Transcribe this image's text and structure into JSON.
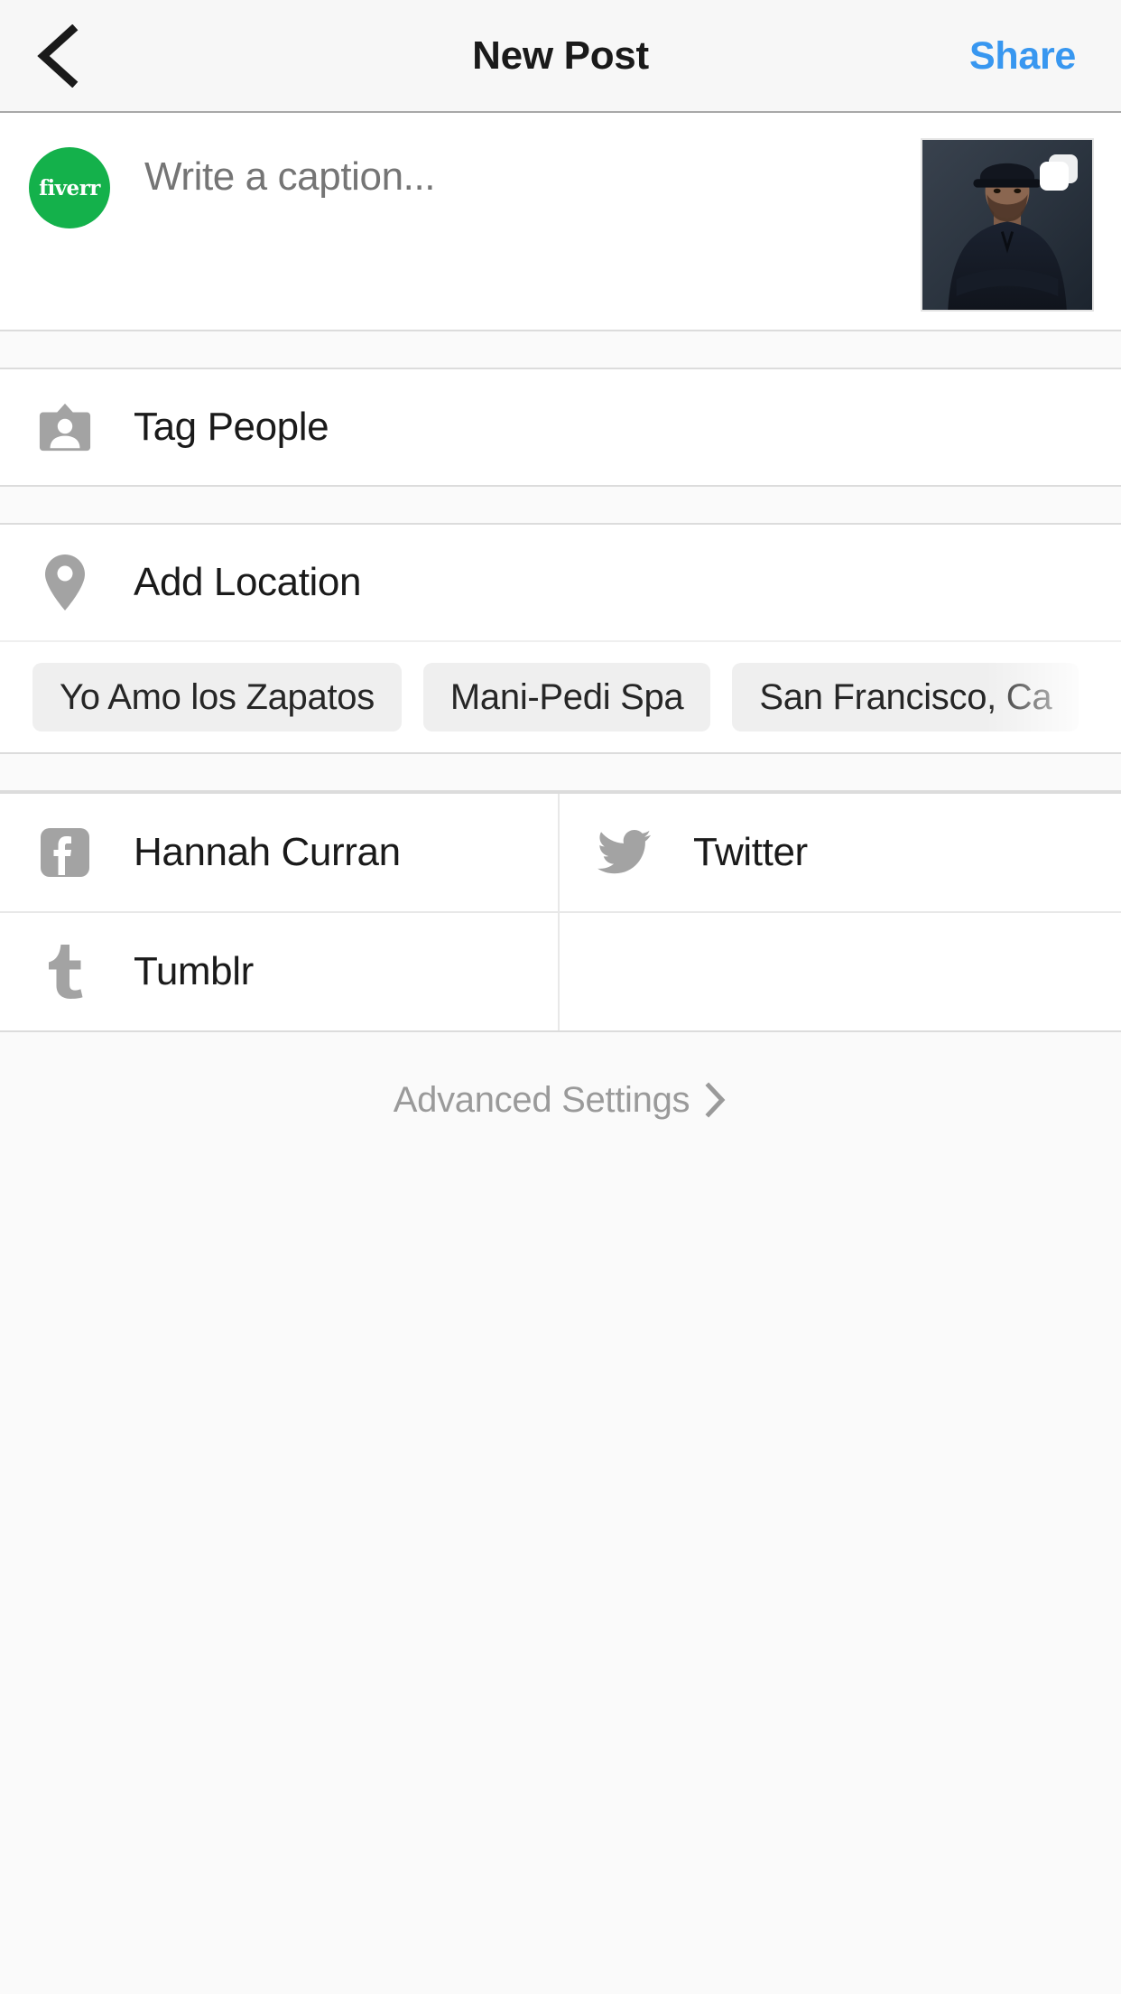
{
  "header": {
    "back_icon": "chevron-left-icon",
    "title": "New Post",
    "share_label": "Share"
  },
  "caption": {
    "avatar_text": "fiverr",
    "avatar_color": "#14B14B",
    "placeholder": "Write a caption...",
    "value": "",
    "thumbnail_alt": "portrait of man wearing a cap with arms crossed",
    "carousel_icon": "multiple-photos-icon"
  },
  "actions": [
    {
      "icon": "tag-people-icon",
      "label": "Tag People"
    },
    {
      "icon": "location-pin-icon",
      "label": "Add Location"
    }
  ],
  "location_suggestions": [
    {
      "label": "Yo Amo los Zapatos"
    },
    {
      "label": "Mani-Pedi Spa"
    },
    {
      "label": "San Francisco, Ca"
    }
  ],
  "social": [
    {
      "icon": "facebook-icon",
      "label": "Hannah Curran"
    },
    {
      "icon": "twitter-icon",
      "label": "Twitter"
    },
    {
      "icon": "tumblr-icon",
      "label": "Tumblr"
    }
  ],
  "advanced": {
    "label": "Advanced Settings",
    "chevron_icon": "chevron-right-icon"
  },
  "colors": {
    "accent": "#3897F0",
    "text": "#1A1A1A",
    "muted": "#9A9A9A",
    "icon_gray": "#A0A0A0",
    "chip_bg": "#EFEFEF",
    "page_bg": "#FAFAFA"
  }
}
